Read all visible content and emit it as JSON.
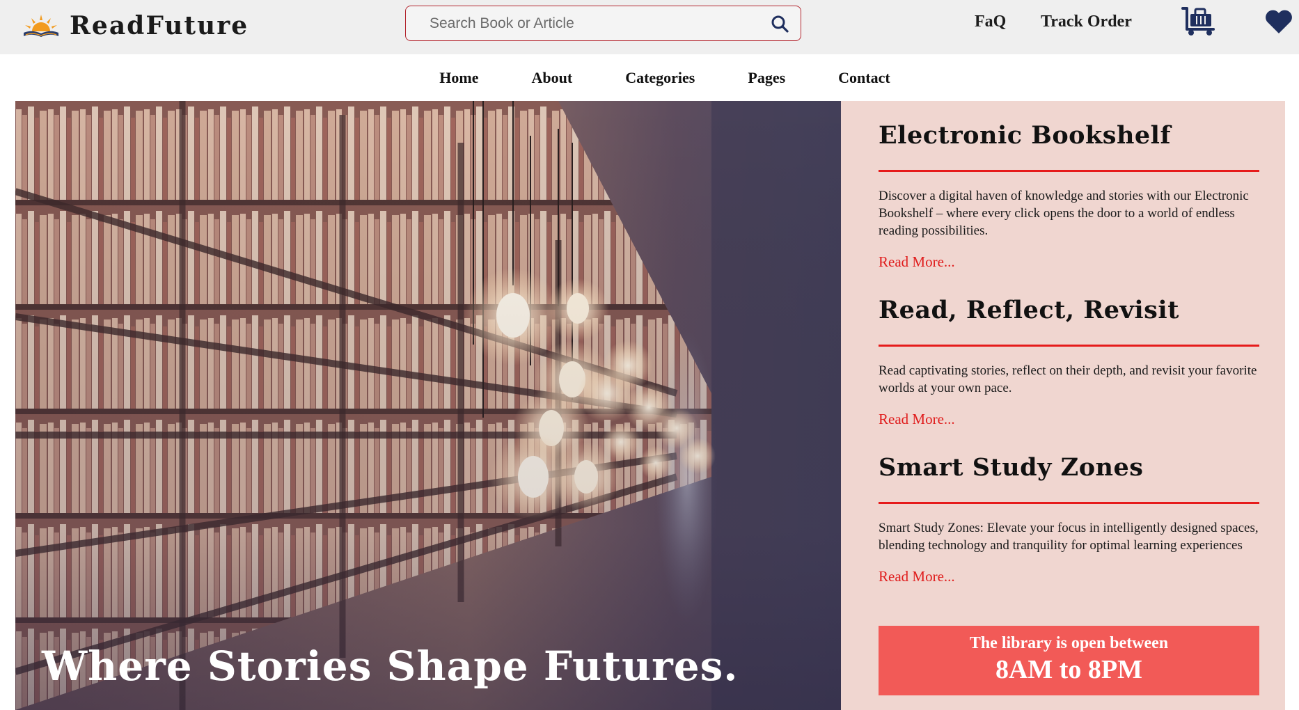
{
  "header": {
    "brand_name": "ReadFuture",
    "logo_icon": "sunrise-book-logo",
    "search": {
      "placeholder": "Search Book or Article",
      "icon": "search-icon"
    },
    "links": {
      "faq": "FaQ",
      "track_order": "Track Order"
    },
    "icons": {
      "cart": "luggage-cart-icon",
      "wishlist": "heart-icon"
    }
  },
  "nav": {
    "items": [
      "Home",
      "About",
      "Categories",
      "Pages",
      "Contact"
    ]
  },
  "hero": {
    "title": "Where Stories Shape Futures.",
    "image": "library-bookshelves-with-hanging-bulbs"
  },
  "side": {
    "articles": [
      {
        "title": "Electronic Bookshelf",
        "body": "Discover a digital haven of knowledge and stories with our Electronic Bookshelf – where every click opens the door to a world of endless reading possibilities.",
        "link": "Read More..."
      },
      {
        "title": "Read, Reflect, Revisit",
        "body": "Read captivating stories, reflect on their depth, and revisit your favorite worlds at your own pace.",
        "link": "Read More..."
      },
      {
        "title": "Smart Study Zones",
        "body": "Smart Study Zones: Elevate your focus in intelligently designed spaces, blending technology and tranquility for optimal learning experiences",
        "link": "Read More..."
      }
    ],
    "hours": {
      "line1": "The library is open between",
      "line2": "8AM to 8PM"
    }
  },
  "colors": {
    "topbar_bg": "#efefef",
    "search_border": "#b3262f",
    "panel_bg": "#f0d6d0",
    "accent_red": "#e01c1c",
    "hours_bg": "#f25a57",
    "icon_navy": "#1f2f5e"
  }
}
